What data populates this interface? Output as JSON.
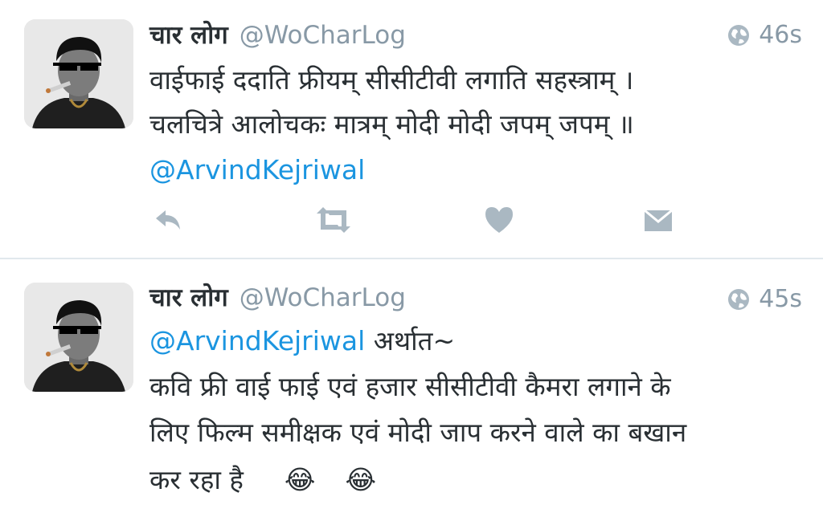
{
  "tweets": [
    {
      "name": "चार लोग",
      "handle": "@WoCharLog",
      "time": "46s",
      "lines": [
        "वाईफाई ददाति फ्रीयम् सीसीटीवी लगाति सहस्त्राम् ।",
        "चलचित्रे आलोचकः मात्रम् मोदी मोदी जपम् जपम् ॥"
      ],
      "mention": "@ArvindKejriwal",
      "actions": [
        "reply-icon",
        "retweet-icon",
        "like-icon",
        "message-icon"
      ]
    },
    {
      "name": "चार लोग",
      "handle": "@WoCharLog",
      "time": "45s",
      "mention": "@ArvindKejriwal",
      "after_mention": "अर्थात~",
      "lines": [
        "कवि फ्री वाई फाई एवं हजार सीसीटीवी कैमरा लगाने के",
        "लिए फिल्म समीक्षक एवं मोदी जाप करने वाले का बखान",
        "कर रहा है"
      ],
      "emojis": [
        "😂",
        "😂"
      ]
    }
  ],
  "colors": {
    "link": "#1b95e0",
    "muted": "#8899a6",
    "text": "#292f33",
    "icon": "#aab8c2"
  }
}
